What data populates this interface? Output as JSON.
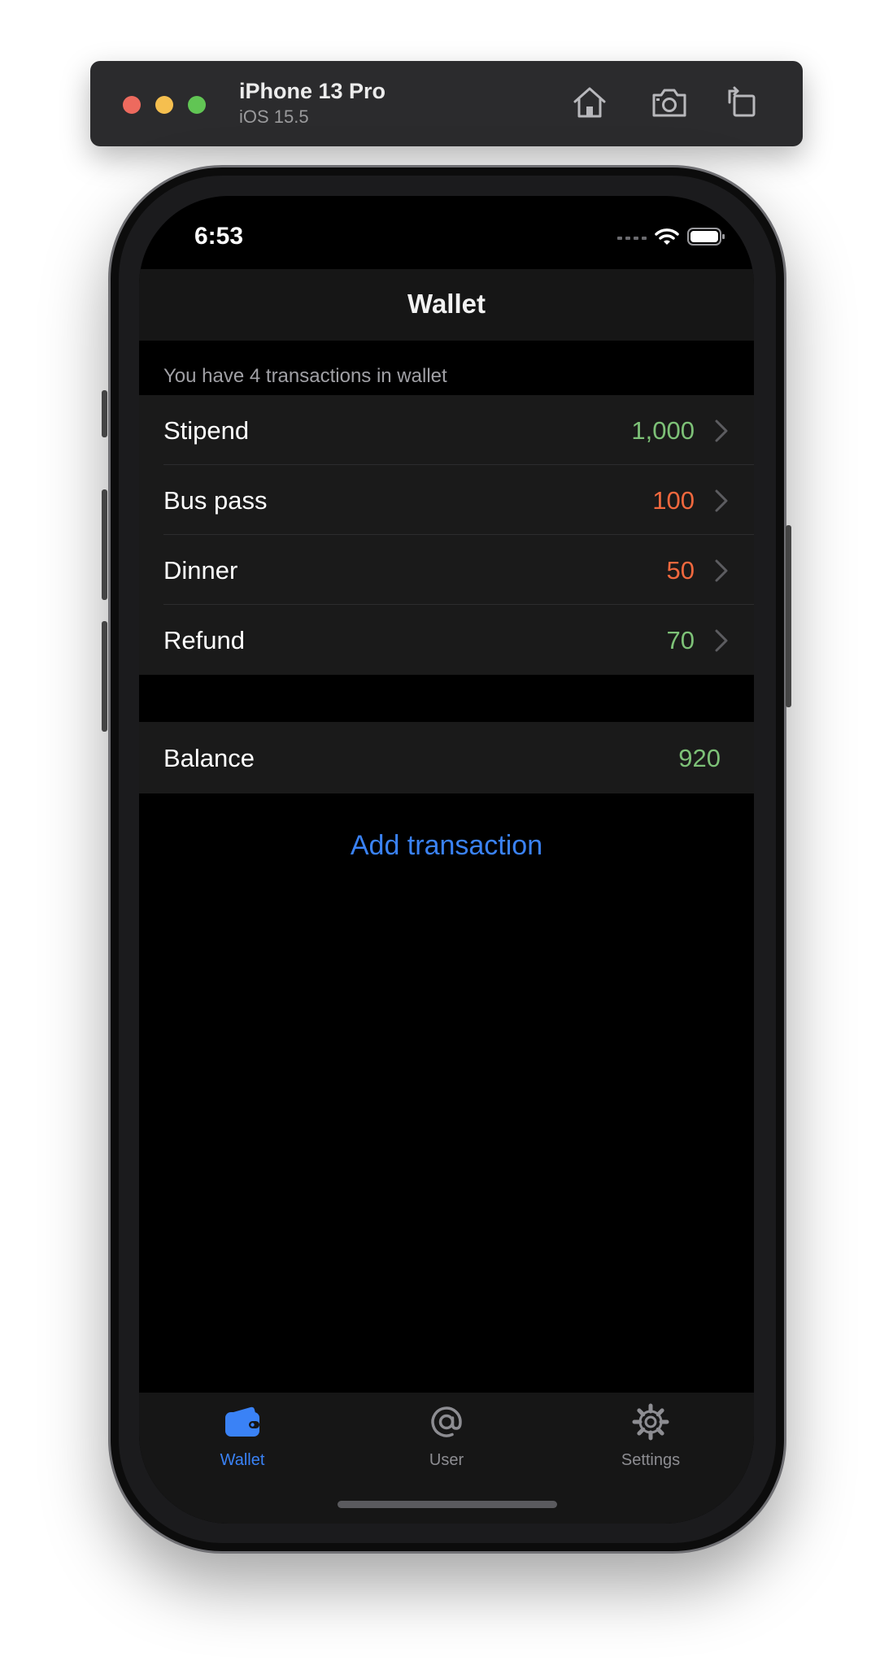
{
  "simulator": {
    "device_name": "iPhone 13 Pro",
    "os_version": "iOS 15.5"
  },
  "status_bar": {
    "time": "6:53"
  },
  "nav": {
    "title": "Wallet"
  },
  "transactions": {
    "header": "You have 4 transactions in wallet",
    "items": [
      {
        "label": "Stipend",
        "value": "1,000",
        "kind": "income"
      },
      {
        "label": "Bus pass",
        "value": "100",
        "kind": "expense"
      },
      {
        "label": "Dinner",
        "value": "50",
        "kind": "expense"
      },
      {
        "label": "Refund",
        "value": "70",
        "kind": "income"
      }
    ]
  },
  "balance": {
    "label": "Balance",
    "value": "920"
  },
  "add_button": {
    "label": "Add transaction"
  },
  "tabs": [
    {
      "label": "Wallet",
      "icon": "wallet-icon",
      "selected": true
    },
    {
      "label": "User",
      "icon": "at-icon",
      "selected": false
    },
    {
      "label": "Settings",
      "icon": "gear-icon",
      "selected": false
    }
  ],
  "colors": {
    "income": "#7dc177",
    "expense": "#f0683e",
    "accent": "#3a82f6",
    "tab_inactive": "#8d8d92"
  }
}
